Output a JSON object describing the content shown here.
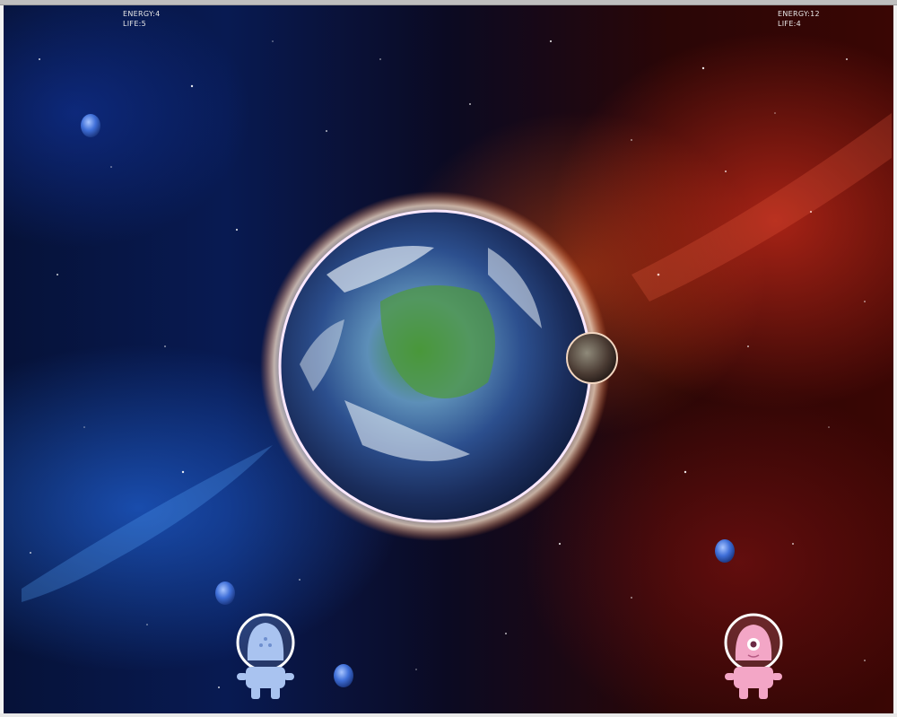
{
  "player1_hud": {
    "energy_label": "ENERGY:4",
    "life_label": "LIFE:5"
  },
  "player2_hud": {
    "energy_label": "ENERGY:12",
    "life_label": "LIFE:4"
  },
  "players": [
    {
      "name": "blue-alien",
      "color": "#a9c3f0"
    },
    {
      "name": "pink-alien",
      "color": "#f3a6c6"
    }
  ],
  "colors": {
    "space_blue": "#0b2a7a",
    "space_red": "#b3190f",
    "energy_orb": "#3f6fd8"
  }
}
